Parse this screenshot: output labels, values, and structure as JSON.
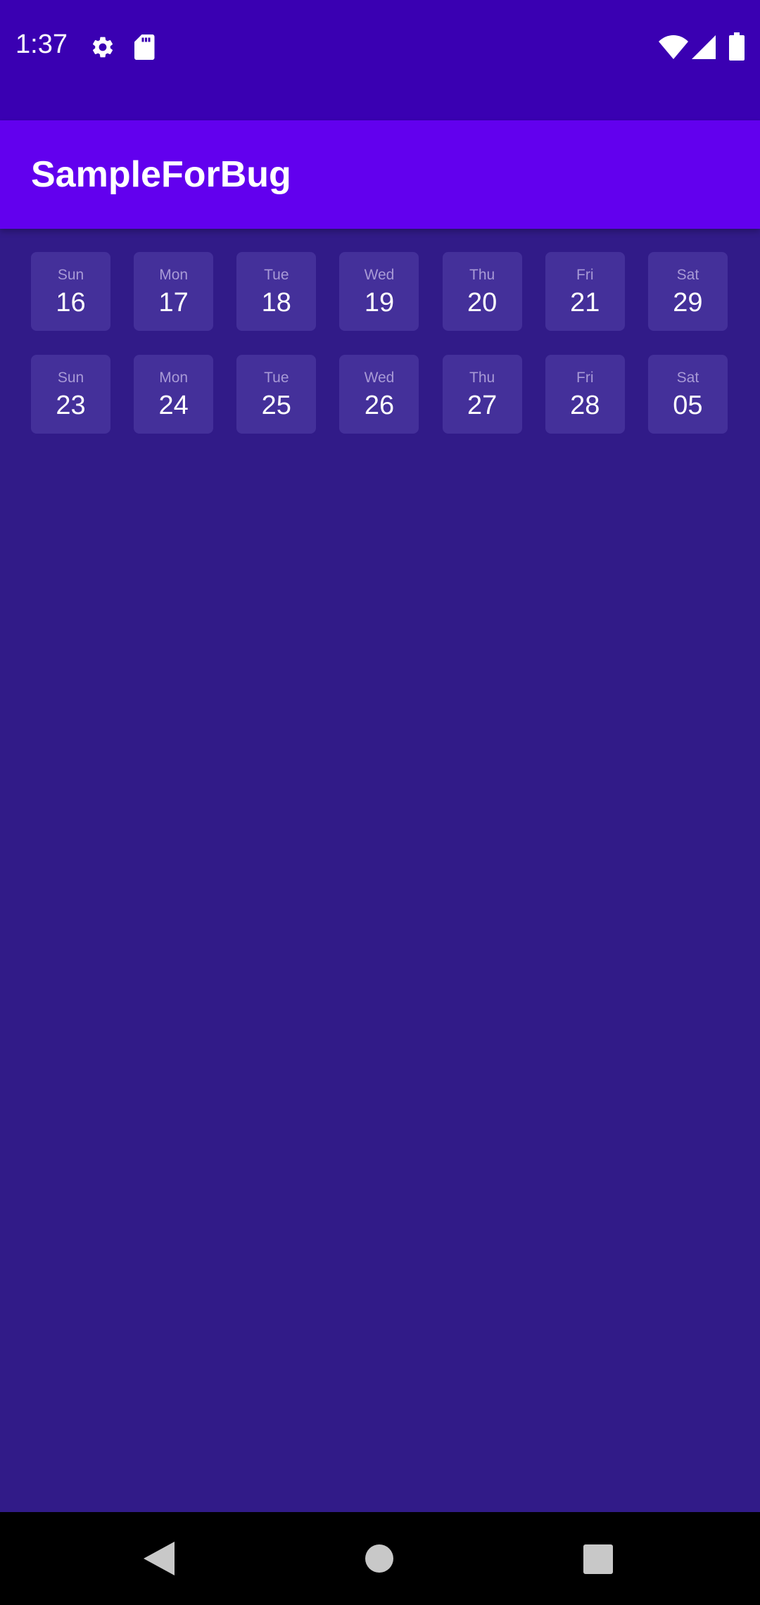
{
  "status_bar": {
    "time": "1:37",
    "left_icons": [
      "gear-icon",
      "sd-card-icon"
    ],
    "right_icons": [
      "wifi-icon",
      "signal-icon",
      "battery-icon"
    ]
  },
  "app_bar": {
    "title": "SampleForBug",
    "color": "#6200ee"
  },
  "calendar": {
    "weeks": [
      [
        {
          "day": "Sun",
          "date": "16"
        },
        {
          "day": "Mon",
          "date": "17"
        },
        {
          "day": "Tue",
          "date": "18"
        },
        {
          "day": "Wed",
          "date": "19"
        },
        {
          "day": "Thu",
          "date": "20"
        },
        {
          "day": "Fri",
          "date": "21"
        },
        {
          "day": "Sat",
          "date": "29"
        }
      ],
      [
        {
          "day": "Sun",
          "date": "23"
        },
        {
          "day": "Mon",
          "date": "24"
        },
        {
          "day": "Tue",
          "date": "25"
        },
        {
          "day": "Wed",
          "date": "26"
        },
        {
          "day": "Thu",
          "date": "27"
        },
        {
          "day": "Fri",
          "date": "28"
        },
        {
          "day": "Sat",
          "date": "05"
        }
      ]
    ]
  },
  "nav_bar": {
    "buttons": [
      "back-icon",
      "home-icon",
      "recents-icon"
    ]
  },
  "colors": {
    "background": "#311b88",
    "status_bar": "#3a00b2",
    "cell": "#44309a"
  }
}
